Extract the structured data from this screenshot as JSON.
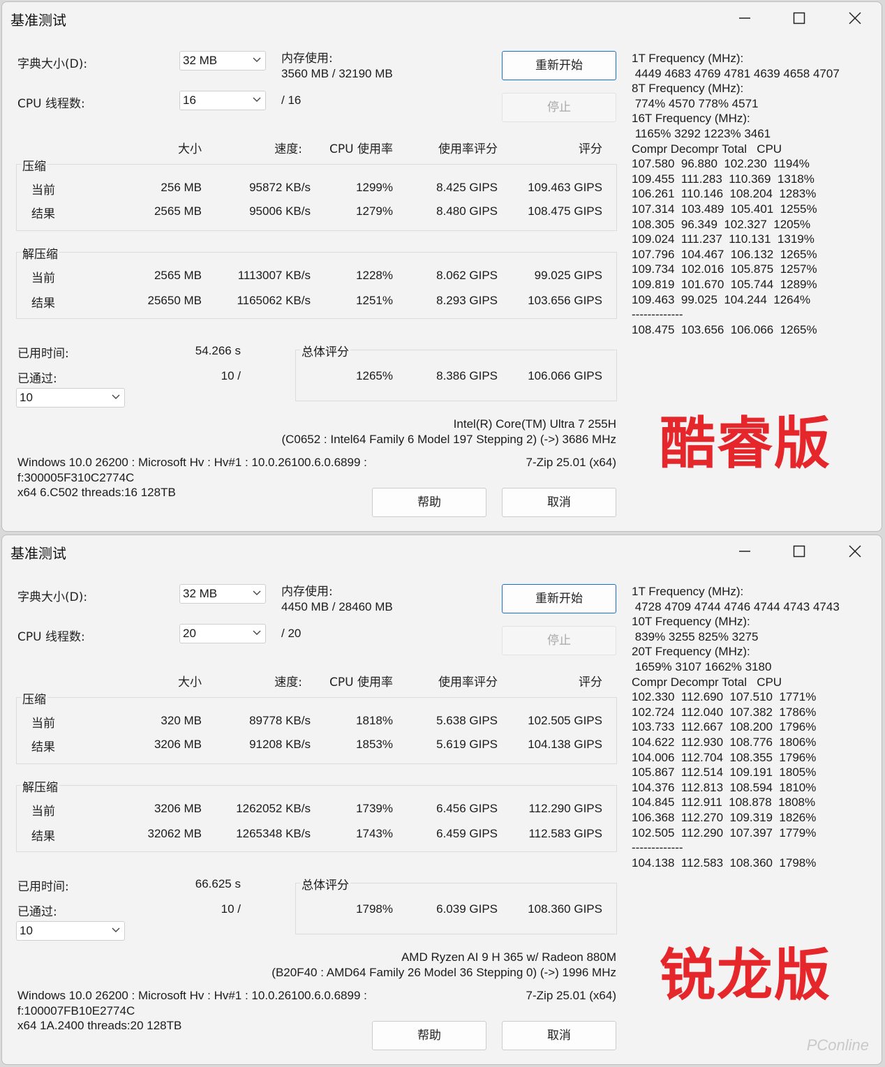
{
  "windows": [
    {
      "title": "基准测试",
      "dict_label": "字典大小(D):",
      "dict_value": "32 MB",
      "mem_label": "内存使用:",
      "mem_value": "3560 MB / 32190 MB",
      "threads_label": "CPU 线程数:",
      "threads_value": "16",
      "threads_total": "/ 16",
      "restart_btn": "重新开始",
      "stop_btn": "停止",
      "headers": {
        "size": "大小",
        "speed": "速度:",
        "cpu": "CPU 使用率",
        "rating_usage": "使用率评分",
        "rating": "评分"
      },
      "compress": {
        "title": "压缩",
        "rows": [
          {
            "label": "当前",
            "size": "256 MB",
            "speed": "95872 KB/s",
            "cpu": "1299%",
            "usage": "8.425 GIPS",
            "rating": "109.463 GIPS"
          },
          {
            "label": "结果",
            "size": "2565 MB",
            "speed": "95006 KB/s",
            "cpu": "1279%",
            "usage": "8.480 GIPS",
            "rating": "108.475 GIPS"
          }
        ]
      },
      "decompress": {
        "title": "解压缩",
        "rows": [
          {
            "label": "当前",
            "size": "2565 MB",
            "speed": "1113007 KB/s",
            "cpu": "1228%",
            "usage": "8.062 GIPS",
            "rating": "99.025 GIPS"
          },
          {
            "label": "结果",
            "size": "25650 MB",
            "speed": "1165062 KB/s",
            "cpu": "1251%",
            "usage": "8.293 GIPS",
            "rating": "103.656 GIPS"
          }
        ]
      },
      "elapsed_label": "已用时间:",
      "elapsed_value": "54.266 s",
      "passed_label": "已通过:",
      "passed_value": "10 /",
      "passes_select": "10",
      "total": {
        "title": "总体评分",
        "cpu": "1265%",
        "usage": "8.386 GIPS",
        "rating": "106.066 GIPS"
      },
      "cpu_name": "Intel(R) Core(TM) Ultra 7 255H",
      "cpu_detail": "(C0652 : Intel64 Family 6 Model 197 Stepping 2) (->) 3686 MHz",
      "os_line": "Windows 10.0 26200 : Microsoft Hv : Hv#1 : 10.0.26100.6.0.6899 :",
      "version": "7-Zip 25.01 (x64)",
      "f_line": "f:300005F310C2774C",
      "x64_line": "x64 6.C502 threads:16 128TB",
      "help_btn": "帮助",
      "cancel_btn": "取消",
      "log": [
        "1T Frequency (MHz):",
        " 4449 4683 4769 4781 4639 4658 4707",
        "8T Frequency (MHz):",
        " 774% 4570 778% 4571",
        "16T Frequency (MHz):",
        " 1165% 3292 1223% 3461",
        "Compr Decompr Total   CPU",
        "107.580  96.880  102.230  1194%",
        "109.455  111.283  110.369  1318%",
        "106.261  110.146  108.204  1283%",
        "107.314  103.489  105.401  1255%",
        "108.305  96.349  102.327  1205%",
        "109.024  111.237  110.131  1319%",
        "107.796  104.467  106.132  1265%",
        "109.734  102.016  105.875  1257%",
        "109.819  101.670  105.744  1289%",
        "109.463  99.025  104.244  1264%",
        "-------------",
        "108.475  103.656  106.066  1265%"
      ],
      "watermark": "酷睿版"
    },
    {
      "title": "基准测试",
      "dict_label": "字典大小(D):",
      "dict_value": "32 MB",
      "mem_label": "内存使用:",
      "mem_value": "4450 MB / 28460 MB",
      "threads_label": "CPU 线程数:",
      "threads_value": "20",
      "threads_total": "/ 20",
      "restart_btn": "重新开始",
      "stop_btn": "停止",
      "headers": {
        "size": "大小",
        "speed": "速度:",
        "cpu": "CPU 使用率",
        "rating_usage": "使用率评分",
        "rating": "评分"
      },
      "compress": {
        "title": "压缩",
        "rows": [
          {
            "label": "当前",
            "size": "320 MB",
            "speed": "89778 KB/s",
            "cpu": "1818%",
            "usage": "5.638 GIPS",
            "rating": "102.505 GIPS"
          },
          {
            "label": "结果",
            "size": "3206 MB",
            "speed": "91208 KB/s",
            "cpu": "1853%",
            "usage": "5.619 GIPS",
            "rating": "104.138 GIPS"
          }
        ]
      },
      "decompress": {
        "title": "解压缩",
        "rows": [
          {
            "label": "当前",
            "size": "3206 MB",
            "speed": "1262052 KB/s",
            "cpu": "1739%",
            "usage": "6.456 GIPS",
            "rating": "112.290 GIPS"
          },
          {
            "label": "结果",
            "size": "32062 MB",
            "speed": "1265348 KB/s",
            "cpu": "1743%",
            "usage": "6.459 GIPS",
            "rating": "112.583 GIPS"
          }
        ]
      },
      "elapsed_label": "已用时间:",
      "elapsed_value": "66.625 s",
      "passed_label": "已通过:",
      "passed_value": "10 /",
      "passes_select": "10",
      "total": {
        "title": "总体评分",
        "cpu": "1798%",
        "usage": "6.039 GIPS",
        "rating": "108.360 GIPS"
      },
      "cpu_name": "AMD Ryzen AI 9 H 365 w/ Radeon 880M",
      "cpu_detail": "(B20F40 : AMD64 Family 26 Model 36 Stepping 0) (->) 1996 MHz",
      "os_line": "Windows 10.0 26200 : Microsoft Hv : Hv#1 : 10.0.26100.6.0.6899 :",
      "version": "7-Zip 25.01 (x64)",
      "f_line": "f:100007FB10E2774C",
      "x64_line": "x64 1A.2400 threads:20 128TB",
      "help_btn": "帮助",
      "cancel_btn": "取消",
      "log": [
        "1T Frequency (MHz):",
        " 4728 4709 4744 4746 4744 4743 4743",
        "10T Frequency (MHz):",
        " 839% 3255 825% 3275",
        "20T Frequency (MHz):",
        " 1659% 3107 1662% 3180",
        "Compr Decompr Total   CPU",
        "102.330  112.690  107.510  1771%",
        "102.724  112.040  107.382  1786%",
        "103.733  112.667  108.200  1796%",
        "104.622  112.930  108.776  1806%",
        "104.006  112.704  108.355  1796%",
        "105.867  112.514  109.191  1805%",
        "104.376  112.813  108.594  1810%",
        "104.845  112.911  108.878  1808%",
        "106.368  112.270  109.319  1826%",
        "102.505  112.290  107.397  1779%",
        "-------------",
        "104.138  112.583  108.360  1798%"
      ],
      "watermark": "锐龙版"
    }
  ],
  "brand": "PConline"
}
